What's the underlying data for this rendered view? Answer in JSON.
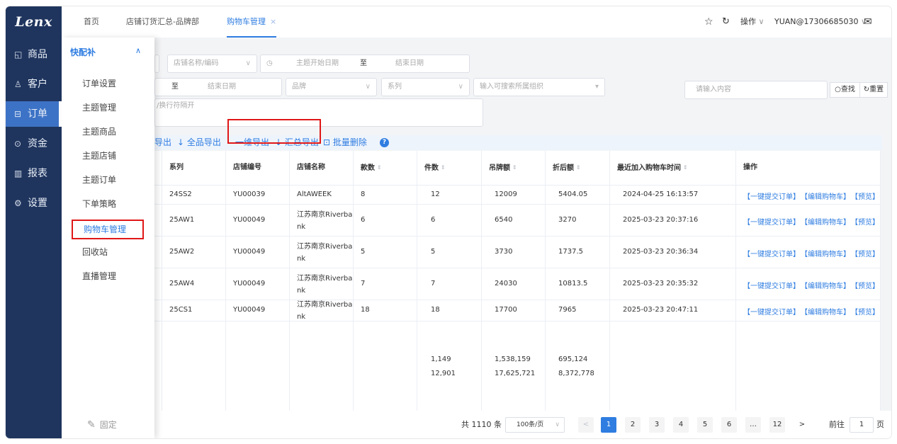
{
  "brand": "Lenx",
  "nav": [
    {
      "icon": "◱",
      "label": "商品"
    },
    {
      "icon": "♙",
      "label": "客户"
    },
    {
      "icon": "⊟",
      "label": "订单"
    },
    {
      "icon": "⊙",
      "label": "资金"
    },
    {
      "icon": "▥",
      "label": "报表"
    },
    {
      "icon": "⚙",
      "label": "设置"
    }
  ],
  "tabs": [
    {
      "label": "首页"
    },
    {
      "label": "店铺订货汇总-品牌部"
    },
    {
      "label": "购物车管理",
      "close": "×"
    }
  ],
  "topright": {
    "star": "☆",
    "refresh": "↻",
    "ops": "操作",
    "ops_caret": "∨",
    "user": "YUAN@17306685030",
    "user_caret": "∨",
    "mail": "✉"
  },
  "sub": {
    "head": "快配补",
    "caret": "∧",
    "items": [
      "订单设置",
      "主题管理",
      "主题商品",
      "主题店铺",
      "主题订单",
      "下单策略",
      "购物车管理",
      "回收站",
      "直播管理"
    ],
    "pin": "固定"
  },
  "filters": {
    "store": "店铺名称/编码",
    "clock": "◷",
    "start_date": "主题开始日期",
    "to": "至",
    "end_date": "结束日期",
    "to2": "至",
    "end_date2": "结束日期",
    "brand": "品牌",
    "series": "系列",
    "org": "输入可搜索所属组织",
    "search": "请输入内容",
    "query_btn": "○查找",
    "reset_btn": "↻重置",
    "textarea_ph": "/换行符隔开",
    "caret": "∨",
    "caret2": "▾"
  },
  "actions": {
    "export1": "导出",
    "export_all": "↓ 全品导出",
    "export_1d": "一维导出",
    "export_sum": "↓ 汇总导出",
    "batch_delete": "⊡ 批量删除",
    "help": "?"
  },
  "columns": [
    "系列",
    "店铺编号",
    "店铺名称",
    "款数",
    "件数",
    "吊牌额",
    "折后额",
    "最近加入购物车时间",
    "操作"
  ],
  "rows": [
    {
      "series": "24SS2",
      "code": "YU00039",
      "name": "AltAWEEK",
      "styles": "8",
      "pieces": "12",
      "tag": "12009",
      "disc": "5404.05",
      "time": "2024-04-25 16:13:57"
    },
    {
      "series": "25AW1",
      "code": "YU00049",
      "name": "江苏南京Riverba nk",
      "styles": "6",
      "pieces": "6",
      "tag": "6540",
      "disc": "3270",
      "time": "2025-03-23 20:37:16"
    },
    {
      "series": "25AW2",
      "code": "YU00049",
      "name": "江苏南京Riverba nk",
      "styles": "5",
      "pieces": "5",
      "tag": "3730",
      "disc": "1737.5",
      "time": "2025-03-23 20:36:34"
    },
    {
      "series": "25AW4",
      "code": "YU00049",
      "name": "江苏南京Riverba nk",
      "styles": "7",
      "pieces": "7",
      "tag": "24030",
      "disc": "10813.5",
      "time": "2025-03-23 20:35:32"
    },
    {
      "series": "25CS1",
      "code": "YU00049",
      "name": "江苏南京Riverba nk",
      "styles": "18",
      "pieces": "18",
      "tag": "17700",
      "disc": "7965",
      "time": "2025-03-23 20:47:11"
    }
  ],
  "row_ops": {
    "submit": "【一键提交订单】",
    "edit": "【编辑购物车】",
    "preview": "【预览】"
  },
  "summary": {
    "pieces1": "1,149",
    "pieces2": "12,901",
    "tag1": "1,538,159",
    "tag2": "17,625,721",
    "disc1": "695,124",
    "disc2": "8,372,778"
  },
  "pager": {
    "total": "共 1110 条",
    "size": "100条/页",
    "size_caret": "∨",
    "prev": "<",
    "pages": [
      "1",
      "2",
      "3",
      "4",
      "5",
      "6",
      "…",
      "12"
    ],
    "next": ">",
    "goto": "前往",
    "page": "1",
    "unit": "页"
  },
  "sort_icon": "⇕"
}
